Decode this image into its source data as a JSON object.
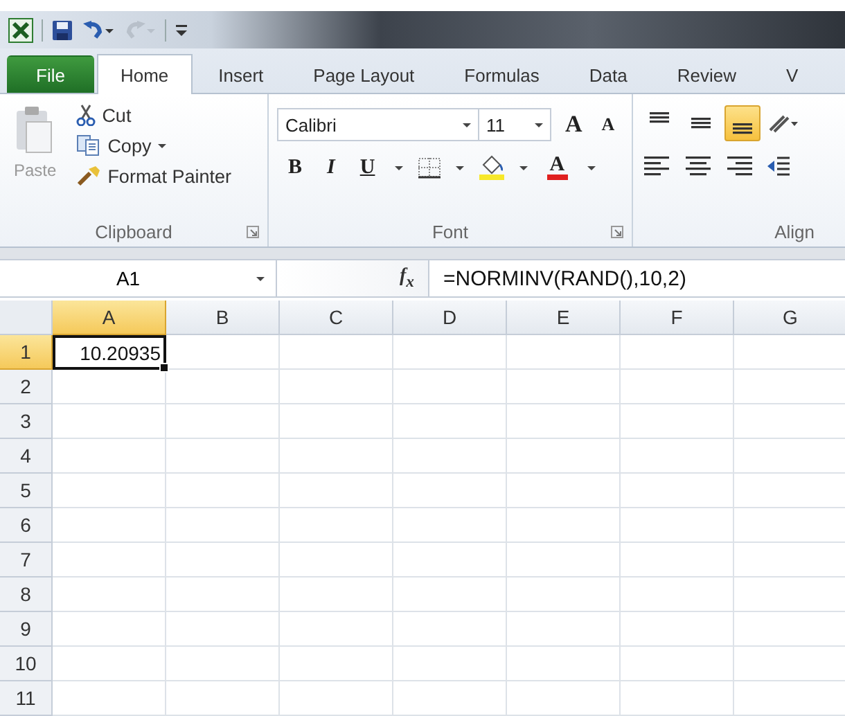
{
  "tabs": [
    {
      "label": "File",
      "kind": "file",
      "selected": false
    },
    {
      "label": "Home",
      "kind": "tab",
      "selected": true
    },
    {
      "label": "Insert",
      "kind": "tab",
      "selected": false
    },
    {
      "label": "Page Layout",
      "kind": "tab",
      "selected": false
    },
    {
      "label": "Formulas",
      "kind": "tab",
      "selected": false
    },
    {
      "label": "Data",
      "kind": "tab",
      "selected": false
    },
    {
      "label": "Review",
      "kind": "tab",
      "selected": false
    },
    {
      "label": "V",
      "kind": "tab",
      "selected": false
    }
  ],
  "ribbon": {
    "clipboard": {
      "label": "Clipboard",
      "paste": {
        "label": "Paste",
        "disabled": true
      },
      "cut": "Cut",
      "copy": "Copy",
      "format_painter": "Format Painter"
    },
    "font": {
      "label": "Font",
      "font_name": "Calibri",
      "font_size": "11",
      "grow": "A",
      "shrink": "A",
      "bold": "B",
      "italic": "I",
      "underline": "U",
      "font_color": "A"
    },
    "alignment": {
      "label": "Align",
      "vertical": [
        {
          "kind": "top",
          "selected": false
        },
        {
          "kind": "middle",
          "selected": false
        },
        {
          "kind": "bottom",
          "selected": true
        }
      ]
    }
  },
  "formula_bar": {
    "name_box": "A1",
    "function_button": "f$_{x}$",
    "formula": "=NORMINV(RAND(),10,2)"
  },
  "sheet": {
    "columns": [
      {
        "label": "A",
        "selected": true
      },
      {
        "label": "B",
        "selected": false
      },
      {
        "label": "C",
        "selected": false
      },
      {
        "label": "D",
        "selected": false
      },
      {
        "label": "E",
        "selected": false
      },
      {
        "label": "F",
        "selected": false
      },
      {
        "label": "G",
        "selected": false
      }
    ],
    "rows": [
      {
        "label": "1",
        "selected": true,
        "cells": [
          {
            "value": "10.20935",
            "active": true
          }
        ]
      },
      {
        "label": "2",
        "selected": false
      },
      {
        "label": "3",
        "selected": false
      },
      {
        "label": "4",
        "selected": false
      },
      {
        "label": "5",
        "selected": false
      },
      {
        "label": "6",
        "selected": false
      },
      {
        "label": "7",
        "selected": false
      },
      {
        "label": "8",
        "selected": false
      },
      {
        "label": "9",
        "selected": false
      },
      {
        "label": "10",
        "selected": false
      },
      {
        "label": "11",
        "selected": false
      }
    ]
  }
}
